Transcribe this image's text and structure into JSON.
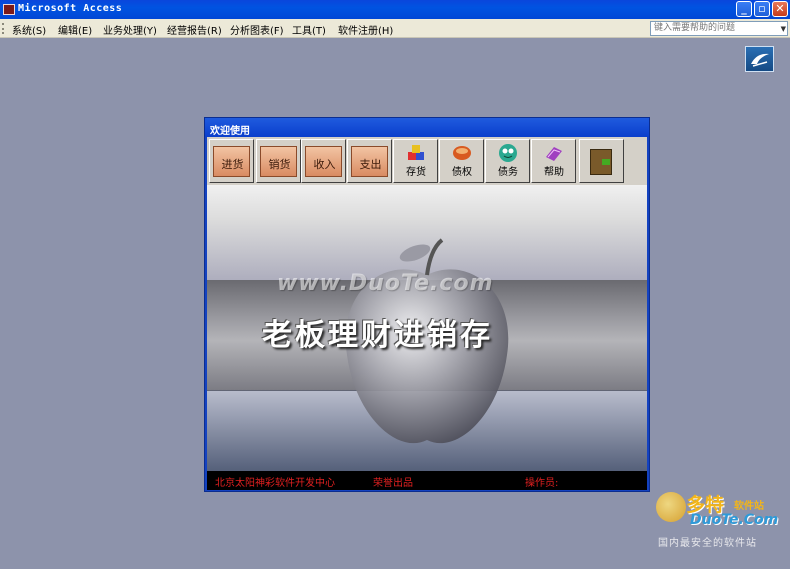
{
  "app": {
    "title": "Microsoft Access",
    "window_buttons": {
      "minimize": "_",
      "maximize": "▫",
      "close": "✕"
    }
  },
  "menu": {
    "items": [
      "系统(S)",
      "编辑(E)",
      "业务处理(Y)",
      "经营报告(R)",
      "分析图表(F)",
      "工具(T)",
      "软件注册(H)"
    ],
    "help_placeholder": "键入需要帮助的问题"
  },
  "welcome": {
    "title": "欢迎使用",
    "toolbar": [
      {
        "label": "进货",
        "icon": "book-icon"
      },
      {
        "label": "销货",
        "icon": "book-icon"
      },
      {
        "label": "收入",
        "icon": "book-icon"
      },
      {
        "label": "支出",
        "icon": "book-icon"
      },
      {
        "label": "存货",
        "icon": "cubes-icon"
      },
      {
        "label": "债权",
        "icon": "coin-bowl-icon"
      },
      {
        "label": "债务",
        "icon": "face-icon"
      },
      {
        "label": "帮助",
        "icon": "help-book-icon"
      },
      {
        "label": "",
        "icon": "exit-door-icon"
      }
    ],
    "banner": {
      "watermark": "www.DuoTe.com",
      "title": "老板理财进销存"
    },
    "status": {
      "developer": "北京太阳神彩软件开发中心",
      "edition": "荣誉出品",
      "operator": "操作员:"
    }
  },
  "site_watermark": {
    "brand": "多特",
    "brand_sub": "软件站",
    "domain": "DuoTe.Com",
    "slogan": "国内最安全的软件站"
  },
  "colors": {
    "desktop": "#8d93ab",
    "titlebar": "#0053e1",
    "menubar": "#ece9d8",
    "status_text": "#e02020"
  }
}
